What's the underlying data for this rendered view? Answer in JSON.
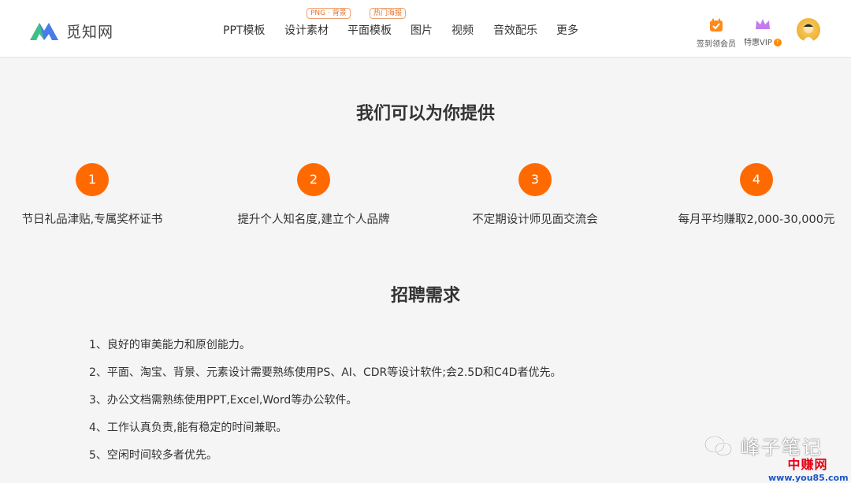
{
  "header": {
    "logo_text": "觅知网",
    "nav": [
      {
        "label": "PPT模板",
        "tag": ""
      },
      {
        "label": "设计素材",
        "tag": "PNG · 背景"
      },
      {
        "label": "平面模板",
        "tag": "热门海报"
      },
      {
        "label": "图片",
        "tag": ""
      },
      {
        "label": "视频",
        "tag": ""
      },
      {
        "label": "音效配乐",
        "tag": ""
      },
      {
        "label": "更多",
        "tag": ""
      }
    ],
    "checkin_label": "签到领会员",
    "vip_label": "特惠VIP",
    "vip_badge": "!",
    "icons": {
      "checkin": "calendar-icon",
      "vip": "crown-icon",
      "avatar": "user-avatar"
    }
  },
  "offer": {
    "title": "我们可以为你提供",
    "items": [
      {
        "num": "1",
        "text": "节日礼品津贴,专属奖杯证书"
      },
      {
        "num": "2",
        "text": "提升个人知名度,建立个人品牌"
      },
      {
        "num": "3",
        "text": "不定期设计师见面交流会"
      },
      {
        "num": "4",
        "text": "每月平均赚取2,000-30,000元"
      }
    ]
  },
  "requirements": {
    "title": "招聘需求",
    "items": [
      "1、良好的审美能力和原创能力。",
      "2、平面、淘宝、背景、元素设计需要熟练使用PS、AI、CDR等设计软件;会2.5D和C4D者优先。",
      "3、办公文档需熟练使用PPT,Excel,Word等办公软件。",
      "4、工作认真负责,能有稳定的时间兼职。",
      "5、空闲时间较多者优先。"
    ]
  },
  "watermark": {
    "account": "峰子笔记",
    "site_cn": "中赚网",
    "site_url": "www.you85.com"
  },
  "colors": {
    "accent": "#ff6a00",
    "background": "#f5f5f5",
    "header": "#ffffff"
  }
}
